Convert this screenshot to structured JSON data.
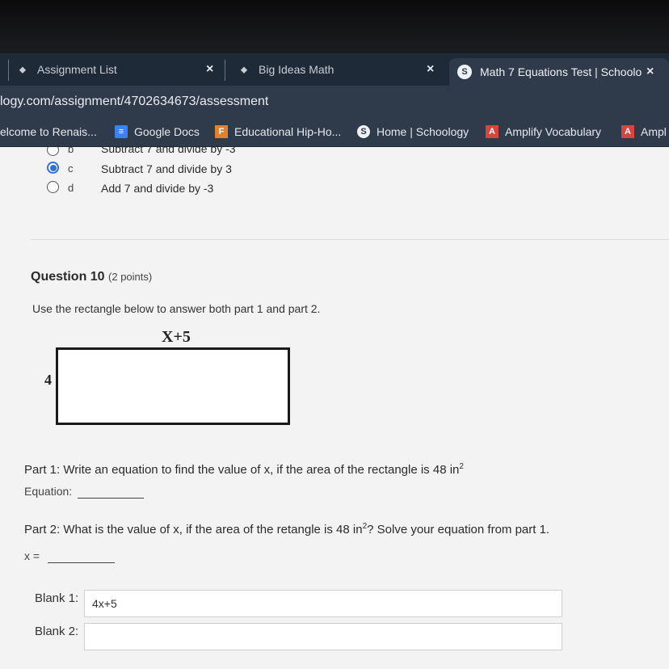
{
  "tabs": [
    {
      "label": "Assignment List",
      "close": "×"
    },
    {
      "label": "Big Ideas Math",
      "close": "×"
    },
    {
      "label": "Math 7 Equations Test | Schoolo",
      "close": "×",
      "logo": "S"
    }
  ],
  "address": {
    "url": "logy.com/assignment/4702634673/assessment"
  },
  "bookmarks": [
    {
      "label": "elcome to Renais...",
      "icon": ""
    },
    {
      "label": "Google Docs",
      "icon": "google-docs-icon"
    },
    {
      "label": "Educational Hip-Ho...",
      "icon": "F"
    },
    {
      "label": "Home | Schoology",
      "icon": "S"
    },
    {
      "label": "Amplify Vocabulary",
      "icon": "A"
    },
    {
      "label": "Ampl",
      "icon": "A"
    }
  ],
  "prev_question": {
    "options": [
      {
        "letter": "b",
        "text": "Subtract 7 and divide by -3",
        "selected": false
      },
      {
        "letter": "c",
        "text": "Subtract 7 and divide by 3",
        "selected": true
      },
      {
        "letter": "d",
        "text": "Add 7 and divide by -3",
        "selected": false
      }
    ]
  },
  "question": {
    "title": "Question 10",
    "points": "(2 points)",
    "prompt": "Use the rectangle below to answer both part 1 and part 2.",
    "rect_top_label": "X+5",
    "rect_side_label": "4",
    "part1_text": "Part 1: Write an equation to find the value of x, if the area of the rectangle is 48 in",
    "part1_sup": "2",
    "equation_label": "Equation:",
    "part2_text_a": "Part 2: What is the value of x, if the area of the retangle is 48 in",
    "part2_sup": "2",
    "part2_text_b": "? Solve your equation from part 1.",
    "x_label": "x ="
  },
  "blanks": [
    {
      "label": "Blank 1:",
      "value": "4x+5"
    },
    {
      "label": "Blank 2:",
      "value": ""
    }
  ],
  "colors": {
    "radio_selected": "#2f6fd6",
    "tab_bar": "#1f2a38",
    "toolbar": "#2f3b4a"
  }
}
